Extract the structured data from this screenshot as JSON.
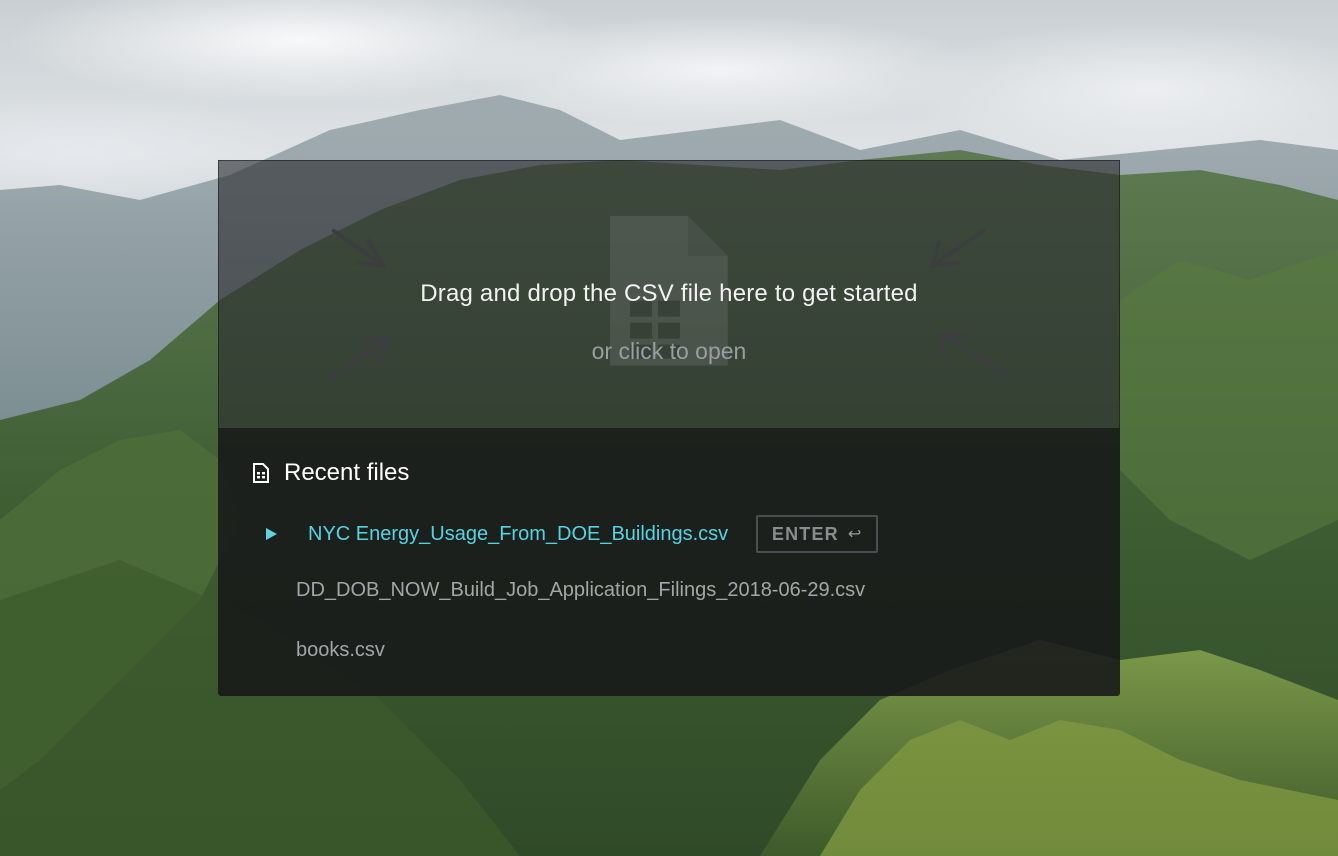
{
  "dropzone": {
    "title": "Drag and drop the CSV file here to get started",
    "subtitle": "or click to open",
    "icon": "file-spreadsheet-icon"
  },
  "recent": {
    "title": "Recent files",
    "icon": "document-icon",
    "files": [
      {
        "name": "NYC Energy_Usage_From_DOE_Buildings.csv",
        "selected": true
      },
      {
        "name": "DD_DOB_NOW_Build_Job_Application_Filings_2018-06-29.csv",
        "selected": false
      },
      {
        "name": "books.csv",
        "selected": false
      }
    ],
    "enter_label": "ENTER",
    "enter_icon": "↩"
  },
  "colors": {
    "accent": "#56d3e2",
    "panel": "#18191a",
    "muted_text": "#a3a6a9"
  }
}
